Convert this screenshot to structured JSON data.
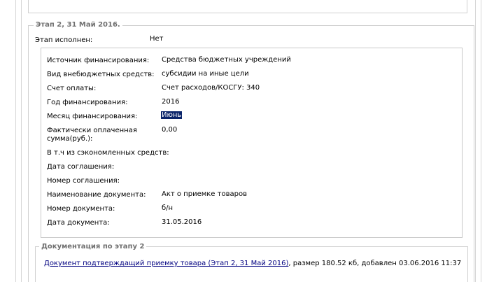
{
  "stage": {
    "legend": "Этап 2, 31 Май 2016.",
    "status_label": "Этап исполнен:",
    "status_value": "Нет"
  },
  "details": [
    {
      "label": "Источник финансирования:",
      "value": "Средства бюджетных учреждений"
    },
    {
      "label": "Вид внебюджетных средств:",
      "value": "субсидии на иные цели"
    },
    {
      "label": "Счет оплаты:",
      "value": "Счет расходов/КОСГУ: 340"
    },
    {
      "label": "Год финансирования:",
      "value": "2016"
    },
    {
      "label": "Месяц финансирования:",
      "value": "Июнь"
    },
    {
      "label": "Фактически оплаченная сумма(руб.):",
      "value": "0,00"
    },
    {
      "label": "В т.ч из сэкономленных средств:",
      "value": ""
    },
    {
      "label": "Дата соглашения:",
      "value": ""
    },
    {
      "label": "Номер соглашения:",
      "value": ""
    },
    {
      "label": "Наименование документа:",
      "value": "Акт о приемке товаров"
    },
    {
      "label": "Номер документа:",
      "value": "б/н"
    },
    {
      "label": "Дата документа:",
      "value": "31.05.2016"
    }
  ],
  "documentation": {
    "legend": "Документация по этапу 2",
    "link_text": "Документ подтверждащий приемку товара (Этап 2, 31 Май 2016)",
    "suffix_text": ", размер 180.52 кб, добавлен 03.06.2016 11:37"
  },
  "colors": {
    "selection_bg": "#0a246a",
    "legend_text": "#707070",
    "link": "#000080",
    "border": "#d0d0d0"
  }
}
